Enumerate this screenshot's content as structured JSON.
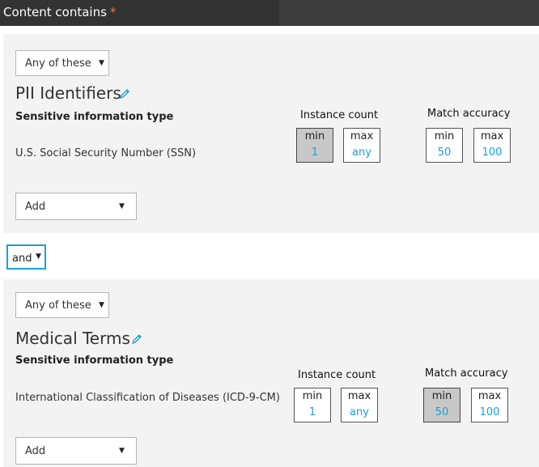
{
  "header": {
    "title": "Content contains",
    "required_mark": "*"
  },
  "groups": [
    {
      "match_mode": "Any of these",
      "title": "PII Identifiers",
      "column_label": "Sensitive information type",
      "item": "U.S. Social Security Number (SSN)",
      "instance_count": {
        "label": "Instance count",
        "min_label": "min",
        "min": "1",
        "max_label": "max",
        "max": "any"
      },
      "match_accuracy": {
        "label": "Match accuracy",
        "min_label": "min",
        "min": "50",
        "max_label": "max",
        "max": "100"
      },
      "add_label": "Add"
    },
    {
      "match_mode": "Any of these",
      "title": "Medical Terms",
      "column_label": "Sensitive information type",
      "item": "International Classification of Diseases (ICD-9-CM)",
      "instance_count": {
        "label": "Instance count",
        "min_label": "min",
        "min": "1",
        "max_label": "max",
        "max": "any"
      },
      "match_accuracy": {
        "label": "Match accuracy",
        "min_label": "min",
        "min": "50",
        "max_label": "max",
        "max": "100"
      },
      "add_label": "Add"
    }
  ],
  "operator": {
    "value": "and"
  },
  "icons": {
    "edit": "pencil-icon",
    "dropdown": "caret-down-icon"
  },
  "colors": {
    "accent": "#1aa0d8",
    "required": "#e8743b",
    "header_bg": "#333333"
  }
}
